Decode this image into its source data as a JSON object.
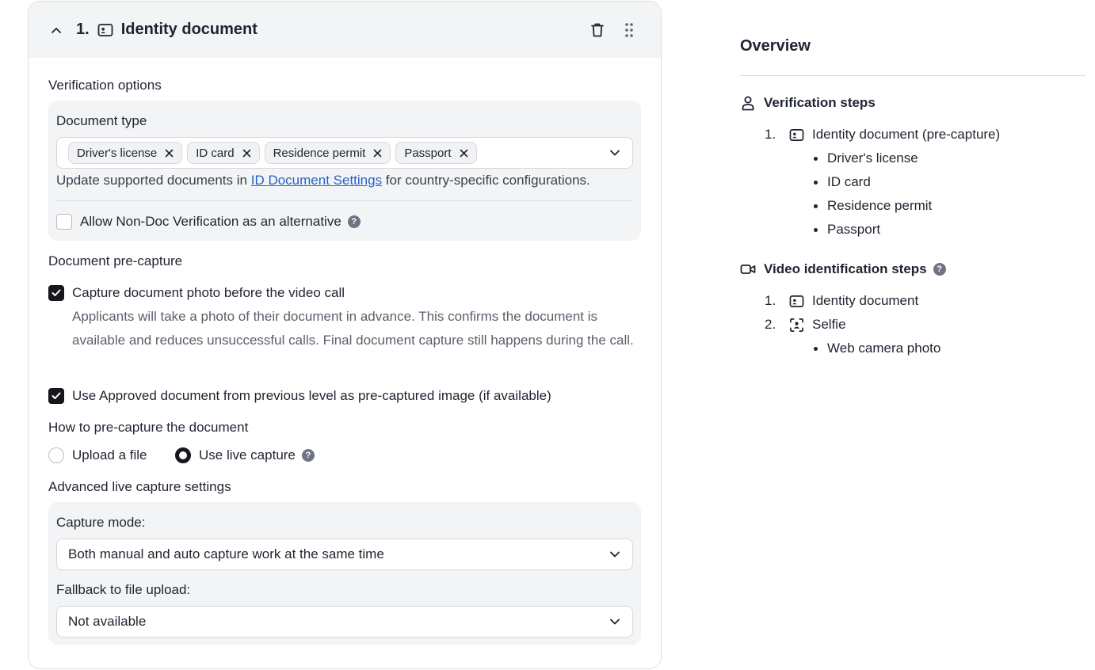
{
  "step": {
    "number": "1.",
    "title": "Identity document",
    "icons": {
      "collapse": "chevron-up-icon",
      "doc": "id-card-icon",
      "delete": "trash-icon",
      "drag": "drag-handle-icon"
    }
  },
  "verification_options": {
    "title": "Verification options",
    "document_type_label": "Document type",
    "chips": [
      "Driver's license",
      "ID card",
      "Residence permit",
      "Passport"
    ],
    "hint_before": "Update supported documents in ",
    "hint_link": "ID Document Settings",
    "hint_after": " for country-specific configurations.",
    "non_doc_label": "Allow Non-Doc Verification as an alternative",
    "non_doc_checked": false,
    "help": "?"
  },
  "precapture": {
    "title": "Document pre-capture",
    "capture_label": "Capture document photo before the video call",
    "capture_checked": true,
    "capture_desc": "Applicants will take a photo of their document in advance. This confirms the document is available and reduces unsuccessful calls. Final document capture still happens during the call.",
    "approved_label": "Use Approved document from previous level as pre-captured image (if available)",
    "approved_checked": true
  },
  "how": {
    "title": "How to pre-capture the document",
    "upload_label": "Upload a file",
    "live_label": "Use live capture",
    "selected": "live"
  },
  "advanced": {
    "title": "Advanced live capture settings",
    "mode_label": "Capture mode:",
    "mode_value": "Both manual and auto capture work at the same time",
    "fallback_label": "Fallback to file upload:",
    "fallback_value": "Not available"
  },
  "overview": {
    "title": "Overview",
    "verification_steps": {
      "title": "Verification steps",
      "items": [
        {
          "number": "1.",
          "label": "Identity document (pre-capture)",
          "icon": "id-card-icon",
          "bullets": [
            "Driver's license",
            "ID card",
            "Residence permit",
            "Passport"
          ]
        }
      ]
    },
    "video_steps": {
      "title": "Video identification steps",
      "help": "?",
      "items": [
        {
          "number": "1.",
          "label": "Identity document",
          "icon": "id-card-icon"
        },
        {
          "number": "2.",
          "label": "Selfie",
          "icon": "face-scan-icon",
          "bullets": [
            "Web camera photo"
          ]
        }
      ]
    }
  },
  "colors": {
    "link": "#2563c9",
    "panel": "#f3f4f6",
    "checked": "#15171c"
  }
}
